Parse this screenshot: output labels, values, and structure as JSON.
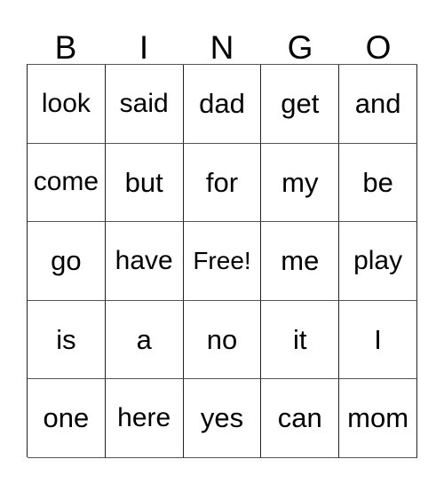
{
  "card": {
    "title": "BINGO",
    "header_letters": [
      "B",
      "I",
      "N",
      "G",
      "O"
    ],
    "free_space_label": "Free!",
    "free_space_position": {
      "row": 2,
      "col": 2
    },
    "colors": {
      "background": "#ffffff",
      "text": "#000000",
      "grid_line": "#222222"
    },
    "rows": [
      {
        "cells": [
          {
            "text": "look"
          },
          {
            "text": "said"
          },
          {
            "text": "dad"
          },
          {
            "text": "get"
          },
          {
            "text": "and"
          }
        ]
      },
      {
        "cells": [
          {
            "text": "come"
          },
          {
            "text": "but"
          },
          {
            "text": "for"
          },
          {
            "text": "my"
          },
          {
            "text": "be"
          }
        ]
      },
      {
        "cells": [
          {
            "text": "go"
          },
          {
            "text": "have"
          },
          {
            "text": "Free!"
          },
          {
            "text": "me"
          },
          {
            "text": "play"
          }
        ]
      },
      {
        "cells": [
          {
            "text": "is"
          },
          {
            "text": "a"
          },
          {
            "text": "no"
          },
          {
            "text": "it"
          },
          {
            "text": "I"
          }
        ]
      },
      {
        "cells": [
          {
            "text": "one"
          },
          {
            "text": "here"
          },
          {
            "text": "yes"
          },
          {
            "text": "can"
          },
          {
            "text": "mom"
          }
        ]
      }
    ]
  }
}
